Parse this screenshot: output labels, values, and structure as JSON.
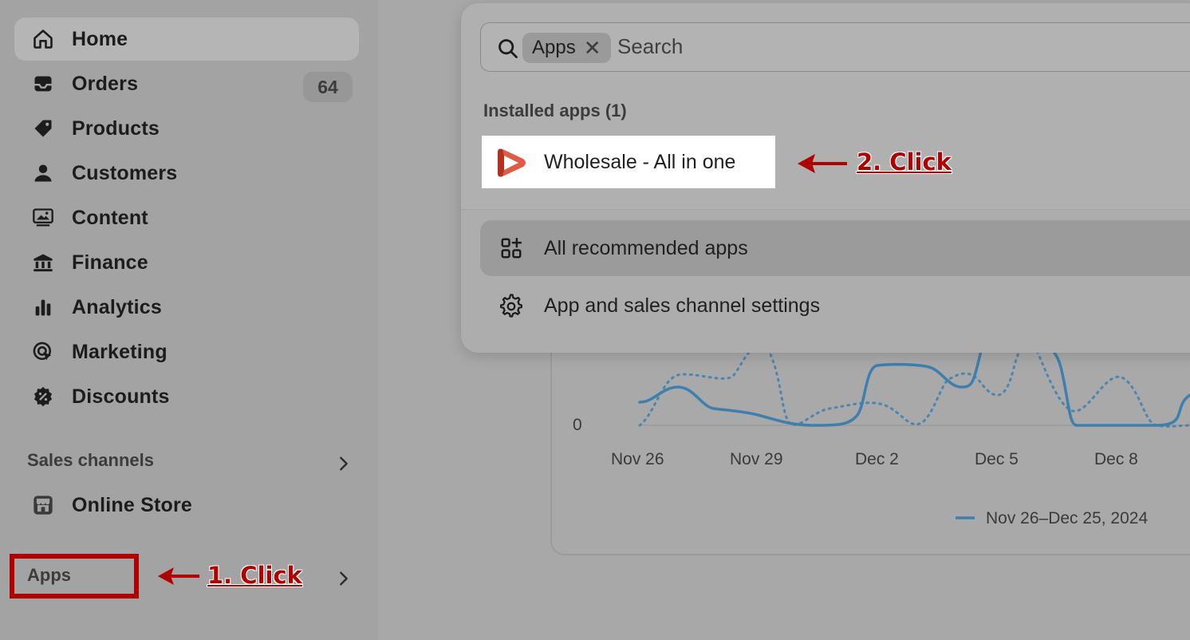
{
  "sidebar": {
    "items": [
      {
        "label": "Home",
        "icon": "home-icon"
      },
      {
        "label": "Orders",
        "icon": "inbox-icon",
        "badge": "64"
      },
      {
        "label": "Products",
        "icon": "tag-icon"
      },
      {
        "label": "Customers",
        "icon": "person-icon"
      },
      {
        "label": "Content",
        "icon": "image-icon"
      },
      {
        "label": "Finance",
        "icon": "bank-icon"
      },
      {
        "label": "Analytics",
        "icon": "bar-chart-icon"
      },
      {
        "label": "Marketing",
        "icon": "target-icon"
      },
      {
        "label": "Discounts",
        "icon": "discount-icon"
      }
    ],
    "sales_channels_title": "Sales channels",
    "online_store_label": "Online Store",
    "apps_title": "Apps"
  },
  "popover": {
    "search": {
      "chip_label": "Apps",
      "chip_remove": "✕",
      "placeholder": "Search"
    },
    "installed_title": "Installed apps (1)",
    "installed_app": "Wholesale - All in one",
    "recommended_label": "All recommended apps",
    "settings_label": "App and sales channel settings"
  },
  "annotations": {
    "step1": "1. Click",
    "step2": "2. Click",
    "color": "#b00000"
  },
  "chart_data": {
    "type": "line",
    "x": [
      "Nov 26",
      "Nov 29",
      "Dec 2",
      "Dec 5",
      "Dec 8"
    ],
    "y_tick_visible": "0",
    "legend": "Nov 26–Dec 25, 2024",
    "series_color": "#3f7fae"
  }
}
